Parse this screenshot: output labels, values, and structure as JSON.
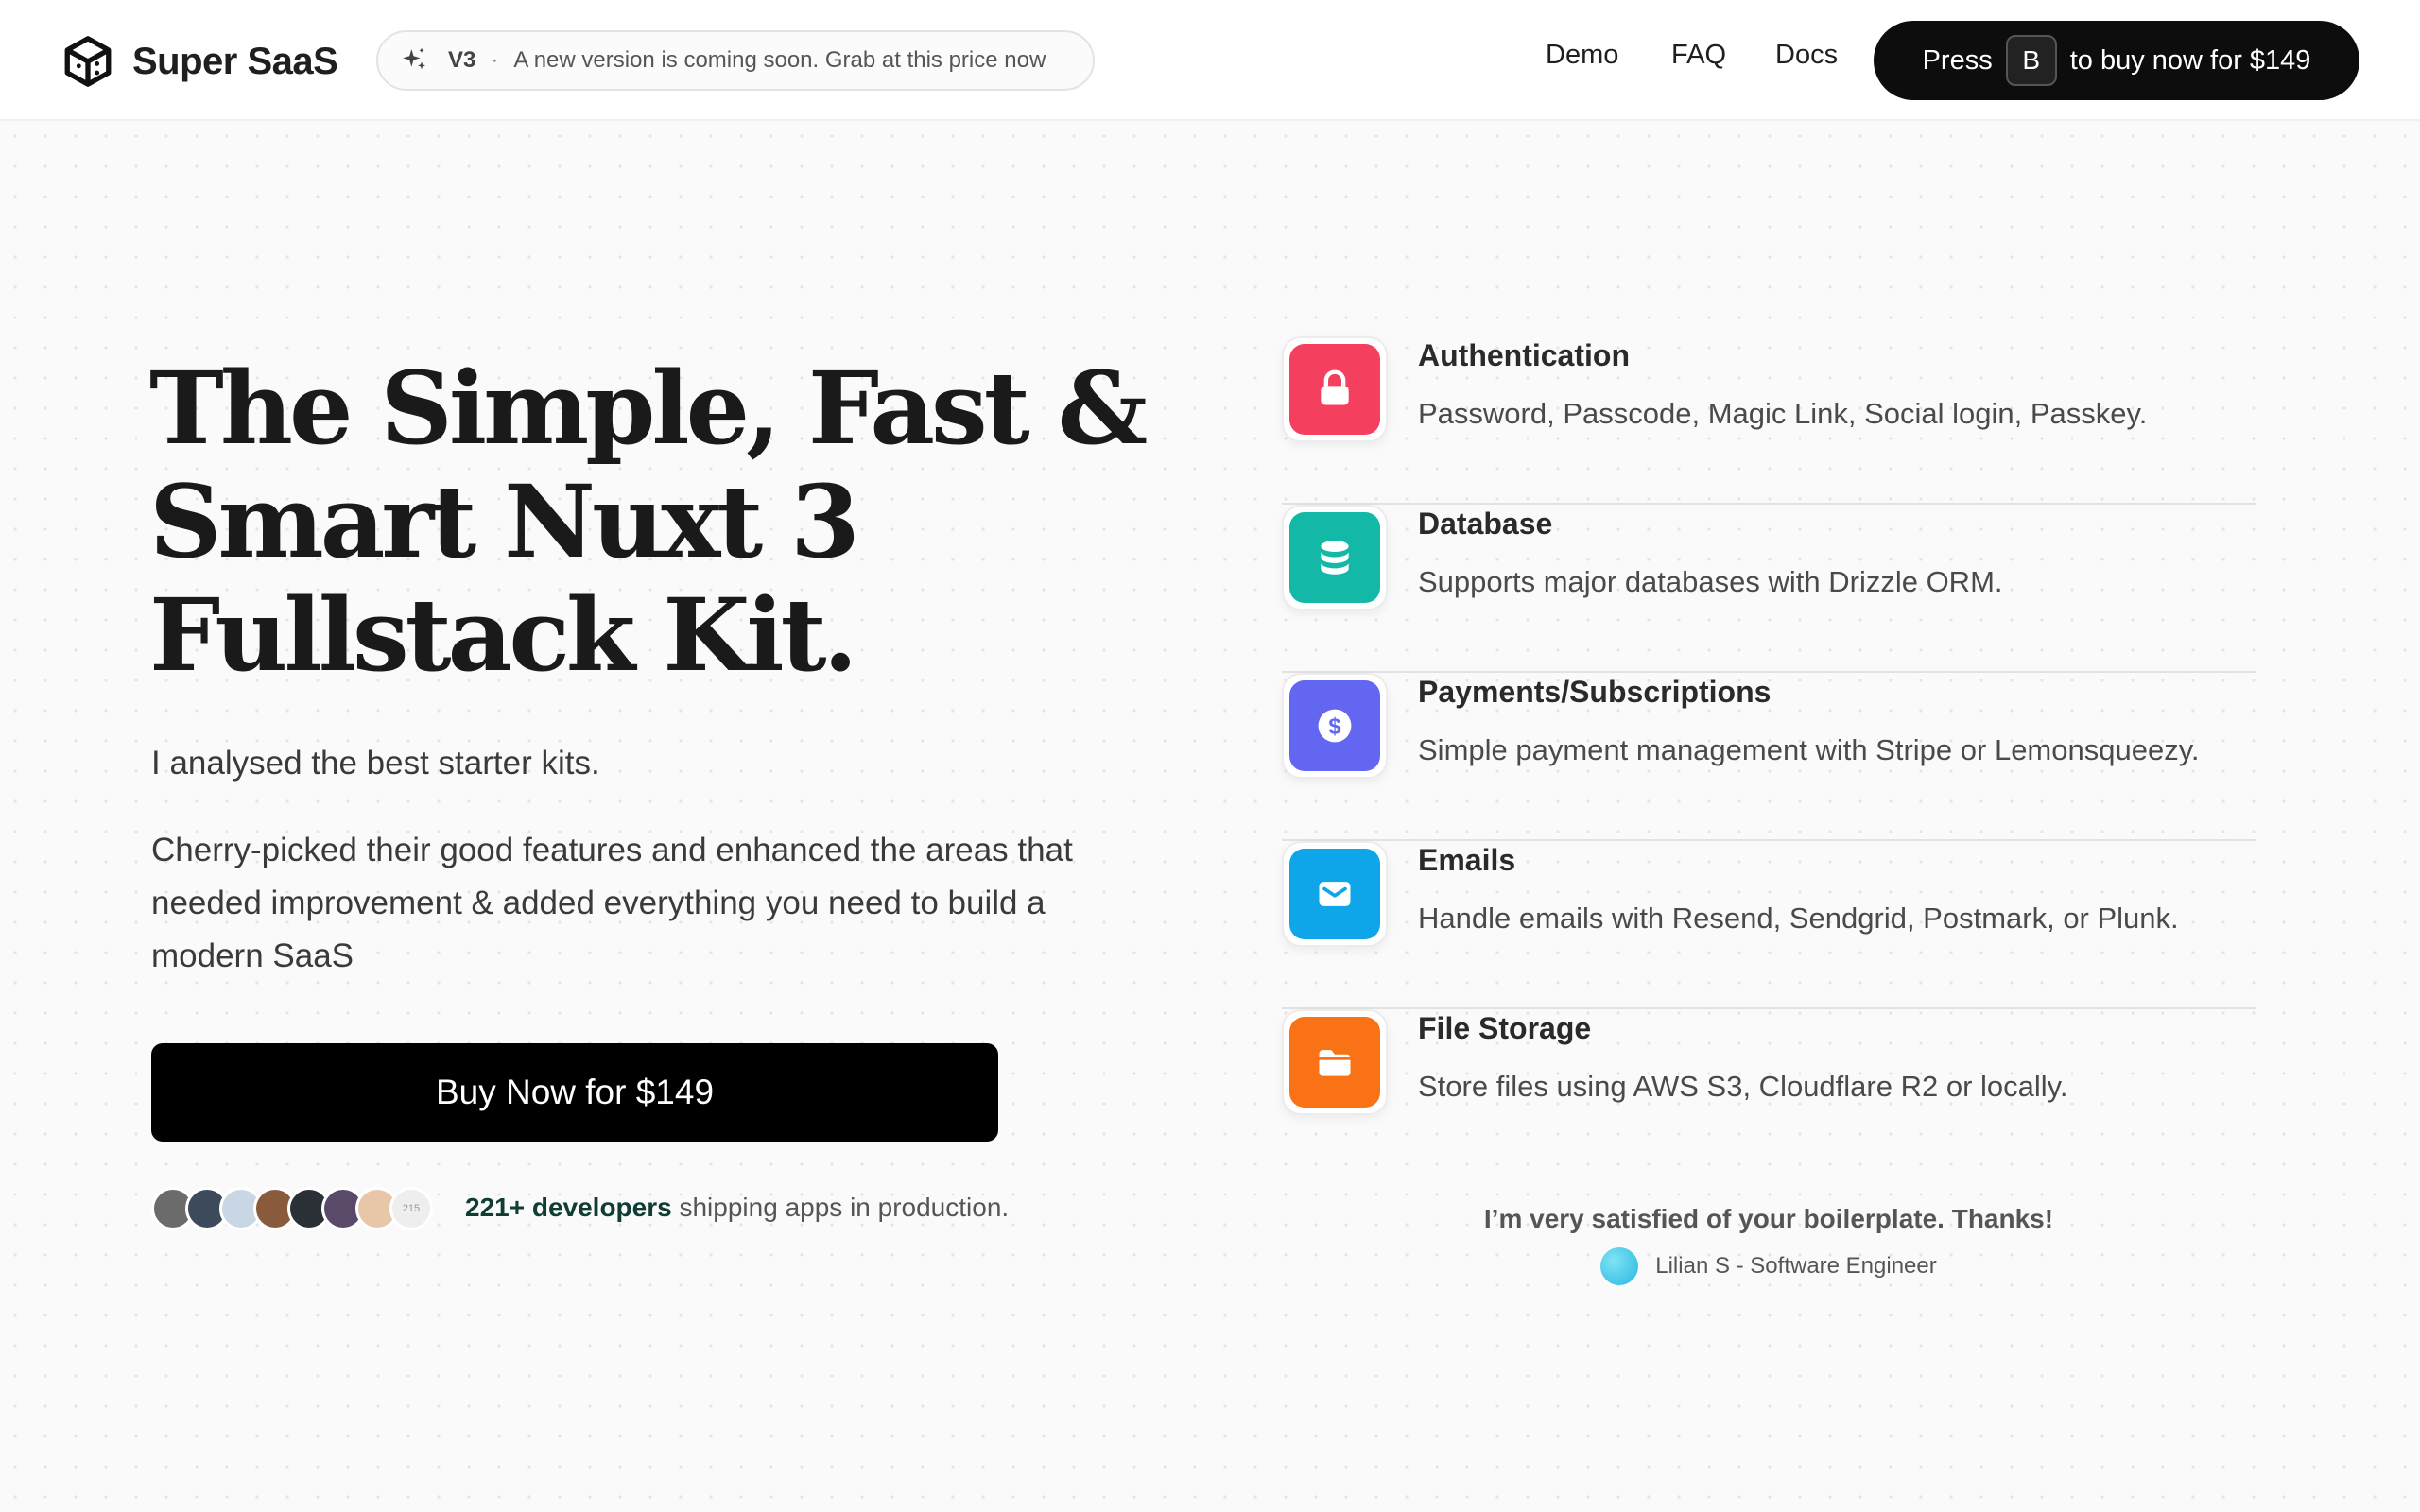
{
  "header": {
    "logo_text": "Super SaaS",
    "announce": {
      "version": "V3",
      "separator": "·",
      "message": "A new version is coming soon. Grab at this price now"
    },
    "nav": [
      "Demo",
      "FAQ",
      "Docs"
    ],
    "cta": {
      "prefix": "Press",
      "key": "B",
      "suffix": "to buy now for $149"
    }
  },
  "hero": {
    "title": "The Simple, Fast & Smart Nuxt 3 Fullstack Kit.",
    "lead": "I analysed the best starter kits.",
    "description": "Cherry-picked their good features and enhanced the areas that needed improvement & added everything you need to build a modern SaaS",
    "buy_button": "Buy Now for $149",
    "avatar_count": "215",
    "social_highlight": "221+ developers",
    "social_text": "shipping apps in production."
  },
  "features": [
    {
      "title": "Authentication",
      "description": "Password, Passcode, Magic Link, Social login, Passkey.",
      "icon": "lock-icon",
      "color": "#f43f5e"
    },
    {
      "title": "Database",
      "description": "Supports major databases with Drizzle ORM.",
      "icon": "database-icon",
      "color": "#14b8a6"
    },
    {
      "title": "Payments/Subscriptions",
      "description": "Simple payment management with Stripe or Lemonsqueezy.",
      "icon": "dollar-icon",
      "color": "#6366f1"
    },
    {
      "title": "Emails",
      "description": "Handle emails with Resend, Sendgrid, Postmark, or Plunk.",
      "icon": "mail-icon",
      "color": "#0ea5e9"
    },
    {
      "title": "File Storage",
      "description": "Store files using AWS S3, Cloudflare R2 or locally.",
      "icon": "folder-icon",
      "color": "#f97316"
    }
  ],
  "testimonial": {
    "quote": "I’m very satisfied of your boilerplate. Thanks!",
    "author": "Lilian S - Software Engineer"
  }
}
